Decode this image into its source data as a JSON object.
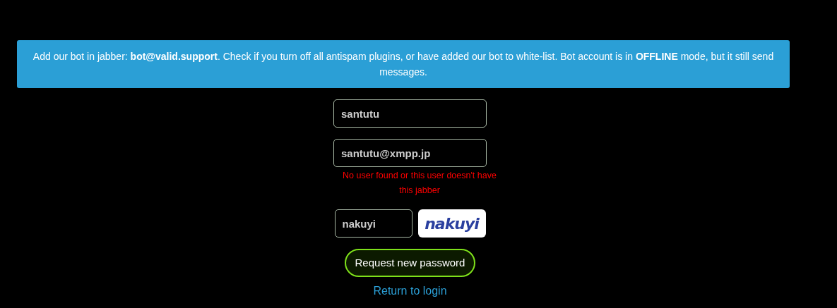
{
  "alert": {
    "text": "Add our bot in jabber: **bot@valid.support**. Check if you turn off all antispam plugins, or have added our bot to white-list. Bot account is in **OFFLINE** mode, but it still send messages."
  },
  "form": {
    "username": {
      "value": "santutu"
    },
    "jabber": {
      "value": "santutu@xmpp.jp",
      "error": "No user found or this user doesn't have this jabber"
    },
    "captcha": {
      "value": "nakuyi",
      "image_text": "nakuyi"
    },
    "submit": {
      "label": "Request new password"
    },
    "return_link": {
      "label": "Return to login"
    }
  }
}
